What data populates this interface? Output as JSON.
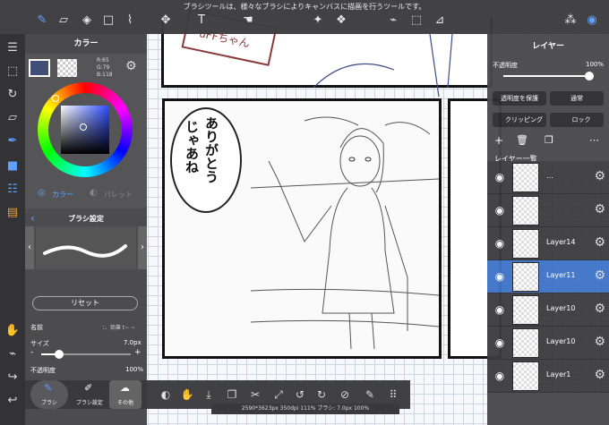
{
  "top_bar": {
    "tooltip": "ブラシツールは、様々なブラシによりキャンバスに描画を行うツールです。"
  },
  "color_panel": {
    "title": "カラー",
    "r": "R:65",
    "g": "G:79",
    "b": "B:118",
    "tab_color": "カラー",
    "tab_palette": "パレット",
    "main_color": "#414f76"
  },
  "brush_panel": {
    "title": "ブラシ設定",
    "reset_label": "リセット",
    "name_label": "名前",
    "name_value": "：、鉛筆 t~ ~",
    "size_label": "サイズ",
    "size_value": "7.0px",
    "opacity_label": "不透明度",
    "opacity_value": "100%",
    "size_fraction": 0.2
  },
  "bottom_tabs": {
    "brush": "ブラシ",
    "brush_settings": "ブラシ設定",
    "other": "その他"
  },
  "status": "2590*3623px 350dpi 111% ブラシ: 7.0px 100%",
  "layer_panel": {
    "title": "レイヤー",
    "opacity_label": "不透明度",
    "opacity_value": "100%",
    "protect_label": "透明度を保護",
    "blend_label": "通常",
    "clipping_label": "クリッピング",
    "lock_label": "ロック",
    "list_title": "レイヤー一覧",
    "opacity_fraction": 1.0,
    "layers": [
      {
        "name": "…",
        "selected": false
      },
      {
        "name": "",
        "selected": false
      },
      {
        "name": "Layer14",
        "selected": false
      },
      {
        "name": "Layer11",
        "selected": true
      },
      {
        "name": "Layer10",
        "selected": false
      },
      {
        "name": "Layer10",
        "selected": false
      },
      {
        "name": "Layer1",
        "selected": false
      }
    ]
  },
  "canvas": {
    "speech_line1": "ありがとう",
    "speech_line2": "じゃあね",
    "sign_text": "uFFちゃん"
  }
}
